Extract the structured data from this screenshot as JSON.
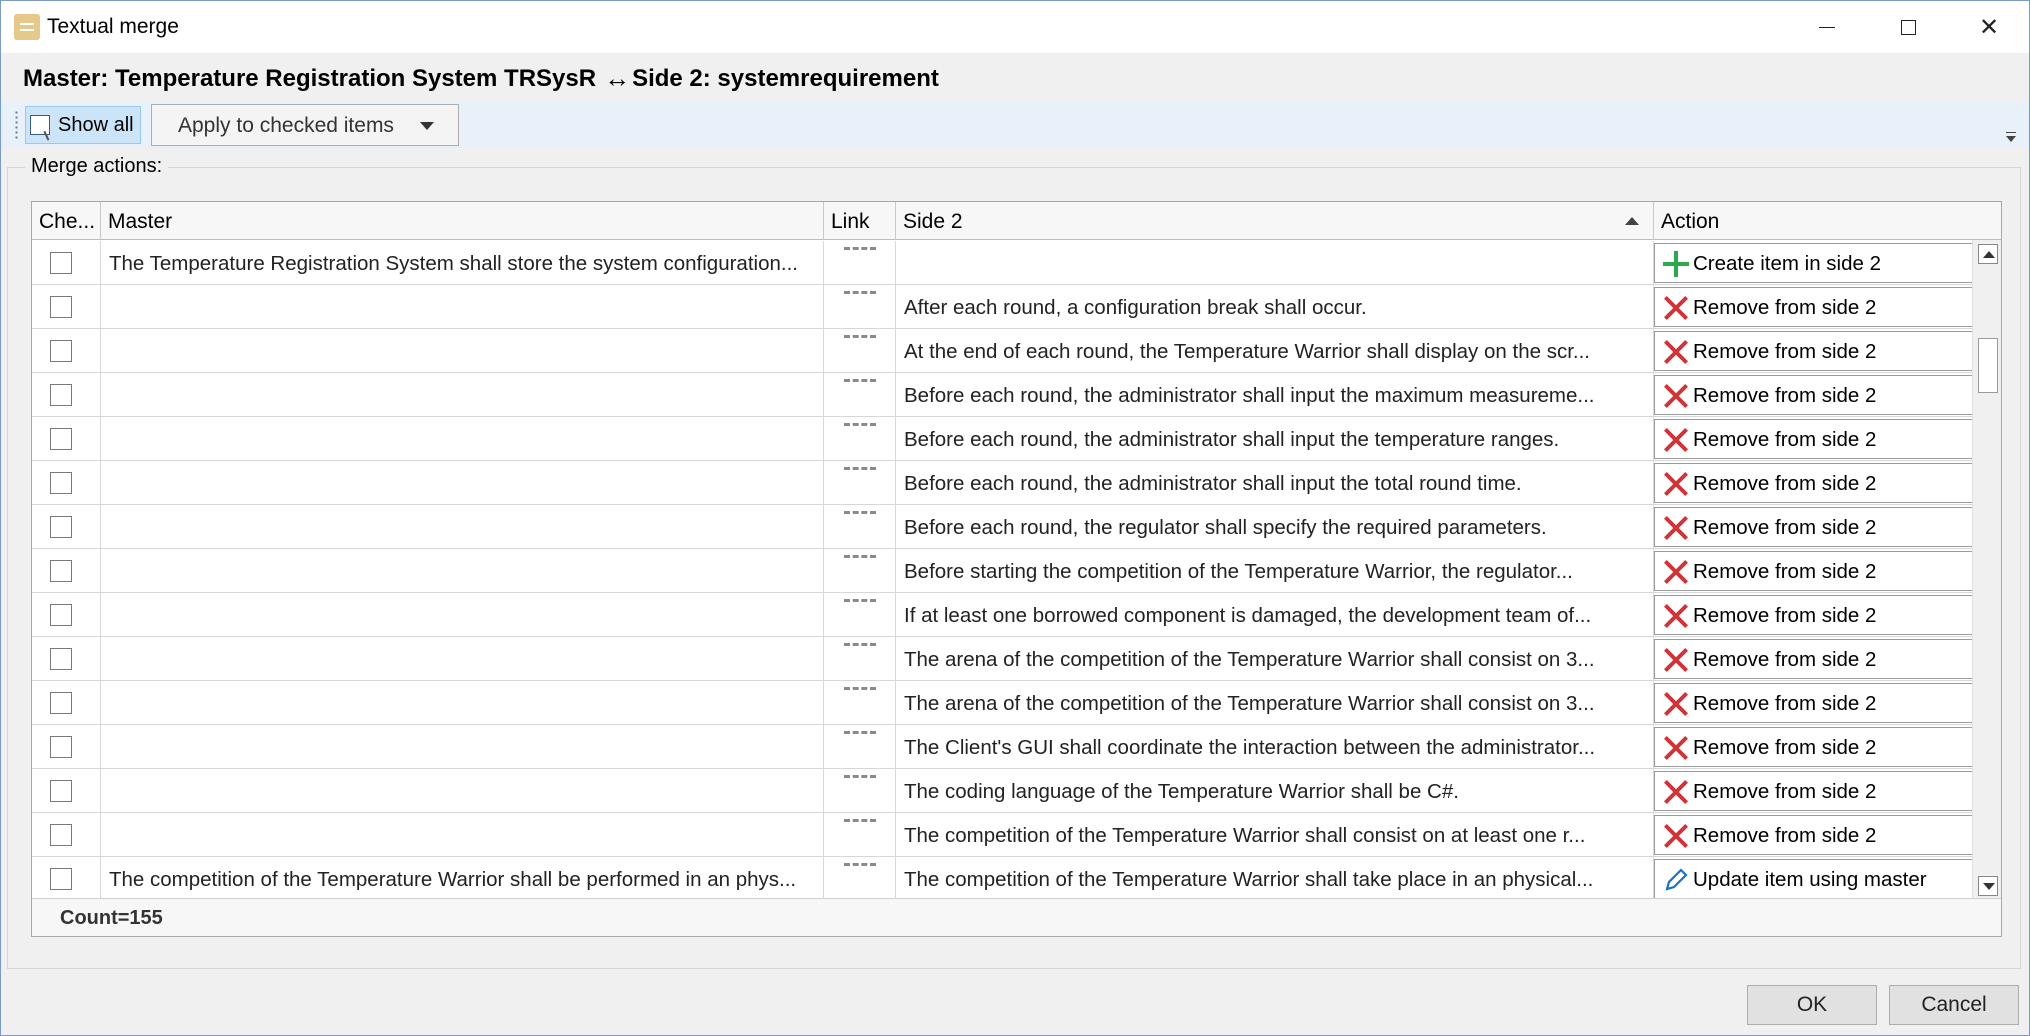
{
  "window": {
    "title": "Textual merge"
  },
  "header": {
    "master_label": "Master: Temperature Registration System TRSysR",
    "arrow": "↔",
    "side2_label": "Side 2: systemrequirement"
  },
  "toolbar": {
    "show_all_label": "Show all",
    "apply_label": "Apply to checked items"
  },
  "group": {
    "label": "Merge actions:"
  },
  "table": {
    "columns": [
      "Che...",
      "Master",
      "Link",
      "Side 2",
      "Action"
    ],
    "rows": [
      {
        "master": "The Temperature Registration System shall store the system configuration...",
        "side2": "",
        "action": "Create item in side 2",
        "action_icon": "plus-icon"
      },
      {
        "master": "",
        "side2": "After each round, a configuration break shall occur.",
        "action": "Remove from side 2",
        "action_icon": "remove-x-icon"
      },
      {
        "master": "",
        "side2": "At the end of each round, the Temperature Warrior shall display on the scr...",
        "action": "Remove from side 2",
        "action_icon": "remove-x-icon"
      },
      {
        "master": "",
        "side2": "Before each round, the administrator shall input the maximum measureme...",
        "action": "Remove from side 2",
        "action_icon": "remove-x-icon"
      },
      {
        "master": "",
        "side2": "Before each round, the administrator shall input the temperature ranges.",
        "action": "Remove from side 2",
        "action_icon": "remove-x-icon"
      },
      {
        "master": "",
        "side2": "Before each round, the administrator shall input the total round time.",
        "action": "Remove from side 2",
        "action_icon": "remove-x-icon"
      },
      {
        "master": "",
        "side2": "Before each round, the regulator shall specify the required parameters.",
        "action": "Remove from side 2",
        "action_icon": "remove-x-icon"
      },
      {
        "master": "",
        "side2": "Before starting the competition of the Temperature Warrior, the regulator...",
        "action": "Remove from side 2",
        "action_icon": "remove-x-icon"
      },
      {
        "master": "",
        "side2": "If at least one borrowed component is damaged, the development team of...",
        "action": "Remove from side 2",
        "action_icon": "remove-x-icon"
      },
      {
        "master": "",
        "side2": "The arena of the competition of the Temperature Warrior shall consist on 3...",
        "action": "Remove from side 2",
        "action_icon": "remove-x-icon"
      },
      {
        "master": "",
        "side2": "The arena of the competition of the Temperature Warrior shall consist on 3...",
        "action": "Remove from side 2",
        "action_icon": "remove-x-icon"
      },
      {
        "master": "",
        "side2": "The Client's GUI shall coordinate the interaction between the administrator...",
        "action": "Remove from side 2",
        "action_icon": "remove-x-icon"
      },
      {
        "master": "",
        "side2": "The coding language of the Temperature Warrior shall be C#.",
        "action": "Remove from side 2",
        "action_icon": "remove-x-icon"
      },
      {
        "master": "",
        "side2": "The competition of the Temperature Warrior shall consist on at least one r...",
        "action": "Remove from side 2",
        "action_icon": "remove-x-icon"
      },
      {
        "master": "The competition of the Temperature Warrior shall be performed in an phys...",
        "side2": "The competition of the Temperature Warrior shall take place in an physical...",
        "action": "Update item using master",
        "action_icon": "pencil-icon"
      }
    ],
    "count_label": "Count=155"
  },
  "buttons": {
    "ok": "OK",
    "cancel": "Cancel"
  },
  "colors": {
    "remove": "#d13438",
    "create": "#2da84a",
    "update": "#1e6fc9",
    "toolbar_bg": "#e8f0fa",
    "show_all_bg": "#cce4f7"
  }
}
